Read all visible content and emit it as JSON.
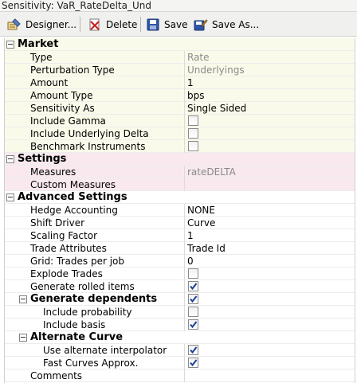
{
  "window": {
    "title": "Sensitivity: VaR_RateDelta_Und"
  },
  "toolbar": {
    "designer": "Designer...",
    "delete": "Delete",
    "save": "Save",
    "save_as": "Save As..."
  },
  "market": {
    "header": "Market",
    "type_label": "Type",
    "type_value": "Rate",
    "perturbation_label": "Perturbation Type",
    "perturbation_value": "Underlyings",
    "amount_label": "Amount",
    "amount_value": "1",
    "amount_type_label": "Amount Type",
    "amount_type_value": "bps",
    "sensitivity_as_label": "Sensitivity As",
    "sensitivity_as_value": "Single Sided",
    "include_gamma_label": "Include Gamma",
    "include_gamma_checked": false,
    "include_underlying_delta_label": "Include Underlying Delta",
    "include_underlying_delta_checked": false,
    "benchmark_label": "Benchmark Instruments",
    "benchmark_checked": false
  },
  "settings": {
    "header": "Settings",
    "measures_label": "Measures",
    "measures_value": "rateDELTA",
    "custom_measures_label": "Custom Measures",
    "custom_measures_value": ""
  },
  "advanced": {
    "header": "Advanced Settings",
    "hedge_label": "Hedge Accounting",
    "hedge_value": "NONE",
    "shift_driver_label": "Shift Driver",
    "shift_driver_value": "Curve",
    "scaling_label": "Scaling Factor",
    "scaling_value": "1",
    "trade_attr_label": "Trade Attributes",
    "trade_attr_value": "Trade Id",
    "grid_label": "Grid: Trades per job",
    "grid_value": "0",
    "explode_label": "Explode Trades",
    "explode_checked": false,
    "rolled_label": "Generate rolled items",
    "rolled_checked": true,
    "dependents_header": "Generate dependents",
    "dependents_checked": true,
    "include_probability_label": "Include probability",
    "include_probability_checked": false,
    "include_basis_label": "Include basis",
    "include_basis_checked": true,
    "alternate_header": "Alternate Curve",
    "alt_interp_label": "Use alternate interpolator",
    "alt_interp_checked": true,
    "fast_curves_label": "Fast Curves Approx.",
    "fast_curves_checked": true,
    "comments_label": "Comments",
    "comments_value": ""
  }
}
